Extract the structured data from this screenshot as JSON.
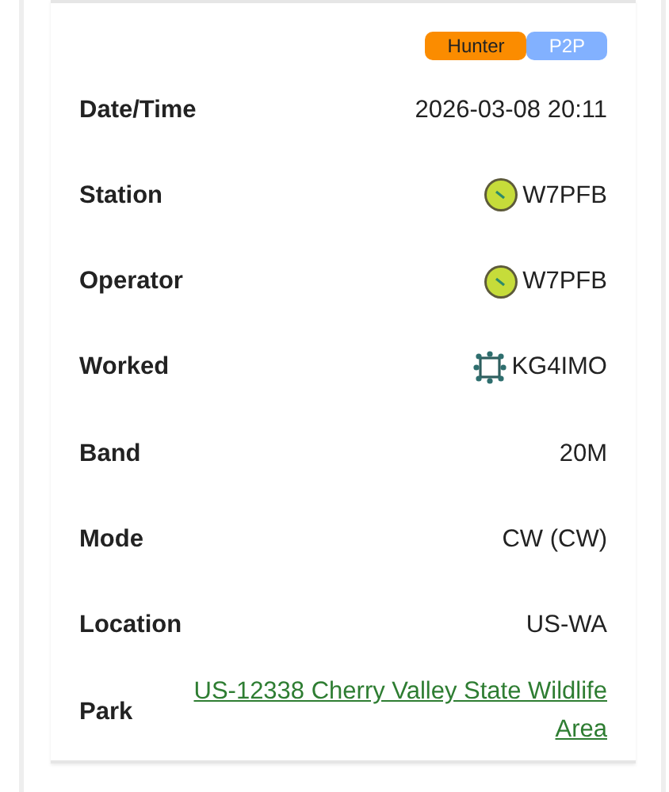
{
  "tags": [
    {
      "label": "Hunter",
      "color": "#fb8c00"
    },
    {
      "label": "P2P",
      "color": "#82b1ff"
    }
  ],
  "rows": [
    {
      "kind": "text",
      "label": "Date/Time",
      "value": "2026-03-08 20:11"
    },
    {
      "kind": "avatar",
      "label": "Station",
      "value": "W7PFB"
    },
    {
      "kind": "avatar",
      "label": "Operator",
      "value": "W7PFB"
    },
    {
      "kind": "emblem",
      "label": "Worked",
      "value": "KG4IMO"
    },
    {
      "kind": "text",
      "label": "Band",
      "value": "20M"
    },
    {
      "kind": "text",
      "label": "Mode",
      "value": "CW (CW)"
    },
    {
      "kind": "text",
      "label": "Location",
      "value": "US-WA"
    },
    {
      "kind": "link",
      "label": "Park",
      "value": "US-12338 Cherry Valley State Wildlife Area"
    }
  ]
}
